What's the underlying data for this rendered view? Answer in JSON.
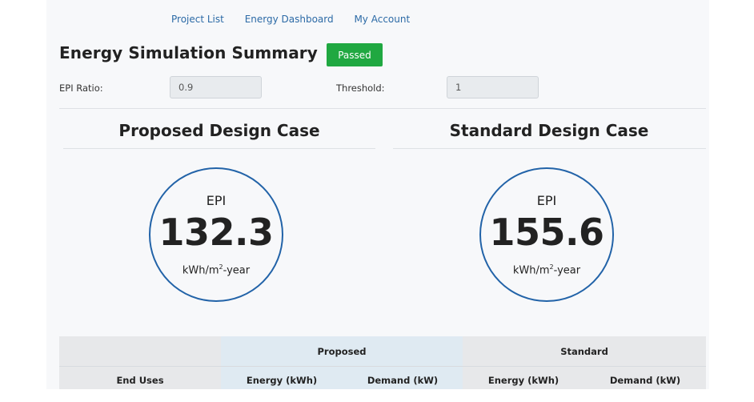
{
  "nav": {
    "links": [
      "Project List",
      "Energy Dashboard",
      "My Account"
    ]
  },
  "header": {
    "title": "Energy Simulation Summary",
    "status_badge": "Passed",
    "status_color": "#20a841"
  },
  "fields": {
    "epi_ratio_label": "EPI Ratio:",
    "epi_ratio_value": "0.9",
    "threshold_label": "Threshold:",
    "threshold_value": "1"
  },
  "cases": [
    {
      "title": "Proposed Design Case",
      "metric": "EPI",
      "value": "132.3",
      "unit_prefix": "kWh/m",
      "unit_sup": "2",
      "unit_suffix": "-year"
    },
    {
      "title": "Standard Design Case",
      "metric": "EPI",
      "value": "155.6",
      "unit_prefix": "kWh/m",
      "unit_sup": "2",
      "unit_suffix": "-year"
    }
  ],
  "table": {
    "group_headers": [
      "",
      "Proposed",
      "Standard"
    ],
    "column_headers": [
      "End Uses",
      "Energy (kWh)",
      "Demand (kW)",
      "Energy (kWh)",
      "Demand (kW)"
    ]
  },
  "colors": {
    "accent_blue": "#2263a8",
    "link": "#2c6aa6"
  }
}
